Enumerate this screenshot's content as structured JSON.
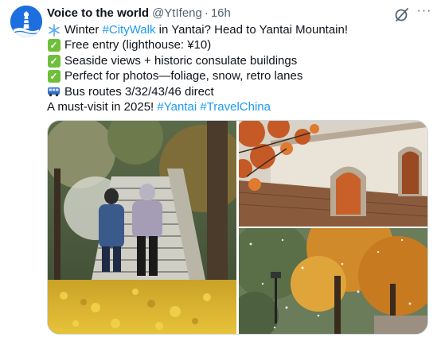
{
  "author": {
    "name": "Voice to the world",
    "handle": "@YtIfeng",
    "separator": "·",
    "time": "16h",
    "avatar_icon": "lighthouse-icon"
  },
  "actions": {
    "grok_icon": "grok-icon",
    "more_label": "···"
  },
  "post": {
    "line1": {
      "emoji_icon": "snowflake-icon",
      "before": "Winter ",
      "hashtag": "#CityWalk",
      "after": " in Yantai? Head to Yantai Mountain!"
    },
    "line2": {
      "emoji_icon": "check-mark-icon",
      "text": "Free entry (lighthouse: ¥10)"
    },
    "line3": {
      "emoji_icon": "check-mark-icon",
      "text": "Seaside views + historic consulate buildings"
    },
    "line4": {
      "emoji_icon": "check-mark-icon",
      "text": "Perfect for photos—foliage, snow, retro lanes"
    },
    "line5": {
      "emoji_icon": "bus-icon",
      "text": "Bus routes 3/32/43/46 direct"
    },
    "line6": {
      "text": "A must-visit in 2025! ",
      "hashtag1": "#Yantai",
      "space": " ",
      "hashtag2": "#TravelChina"
    }
  },
  "media": [
    {
      "description_icon": "snowy-stairs-photo"
    },
    {
      "description_icon": "historic-building-photo"
    },
    {
      "description_icon": "autumn-trees-snow-photo"
    }
  ],
  "colors": {
    "link": "#1d9bf0",
    "text": "#0f1419",
    "muted": "#536471",
    "avatar_bg": "#1d6fe0",
    "check_green": "#6fbf3a"
  }
}
